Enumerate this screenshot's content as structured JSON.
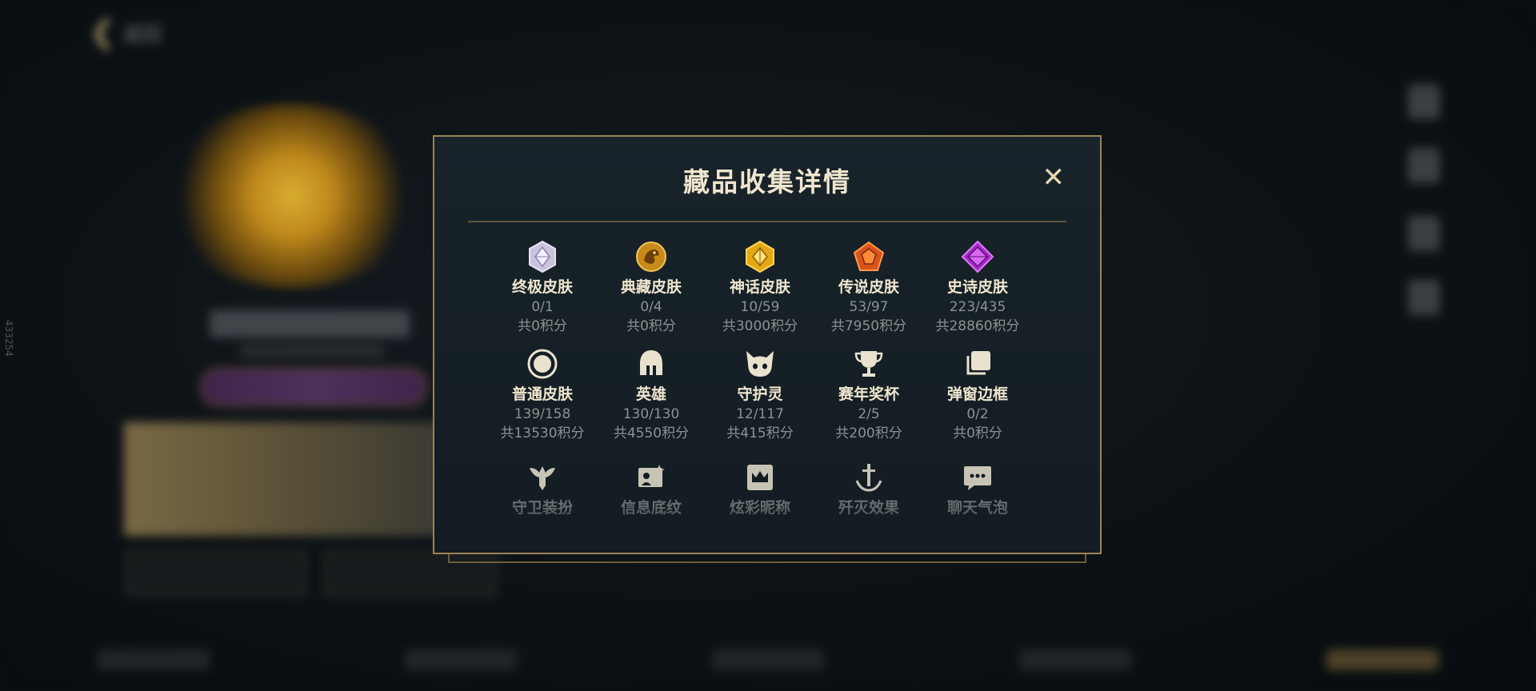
{
  "background": {
    "back_label": "返回",
    "side_id": "433254"
  },
  "modal": {
    "title": "藏品收集详情",
    "close_label": "✕",
    "items": [
      {
        "label": "终极皮肤",
        "progress": "0/1",
        "points": "共0积分",
        "icon": "ultimate-gem-icon"
      },
      {
        "label": "典藏皮肤",
        "progress": "0/4",
        "points": "共0积分",
        "icon": "collector-dragon-icon"
      },
      {
        "label": "神话皮肤",
        "progress": "10/59",
        "points": "共3000积分",
        "icon": "mythic-gem-icon"
      },
      {
        "label": "传说皮肤",
        "progress": "53/97",
        "points": "共7950积分",
        "icon": "legendary-gem-icon"
      },
      {
        "label": "史诗皮肤",
        "progress": "223/435",
        "points": "共28860积分",
        "icon": "epic-gem-icon"
      },
      {
        "label": "普通皮肤",
        "progress": "139/158",
        "points": "共13530积分",
        "icon": "ring-icon"
      },
      {
        "label": "英雄",
        "progress": "130/130",
        "points": "共4550积分",
        "icon": "helmet-icon"
      },
      {
        "label": "守护灵",
        "progress": "12/117",
        "points": "共415积分",
        "icon": "guardian-spirit-icon"
      },
      {
        "label": "赛年奖杯",
        "progress": "2/5",
        "points": "共200积分",
        "icon": "trophy-icon"
      },
      {
        "label": "弹窗边框",
        "progress": "0/2",
        "points": "共0积分",
        "icon": "frames-icon"
      }
    ],
    "more_items": [
      {
        "label": "守卫装扮",
        "icon": "ward-icon"
      },
      {
        "label": "信息底纹",
        "icon": "card-sparkle-icon"
      },
      {
        "label": "炫彩昵称",
        "icon": "crown-card-icon"
      },
      {
        "label": "歼灭效果",
        "icon": "anchor-icon"
      },
      {
        "label": "聊天气泡",
        "icon": "chat-bubble-icon"
      }
    ]
  },
  "colors": {
    "accent_gold": "#9c8455",
    "title": "#efe6cf",
    "muted": "#8e9190"
  }
}
